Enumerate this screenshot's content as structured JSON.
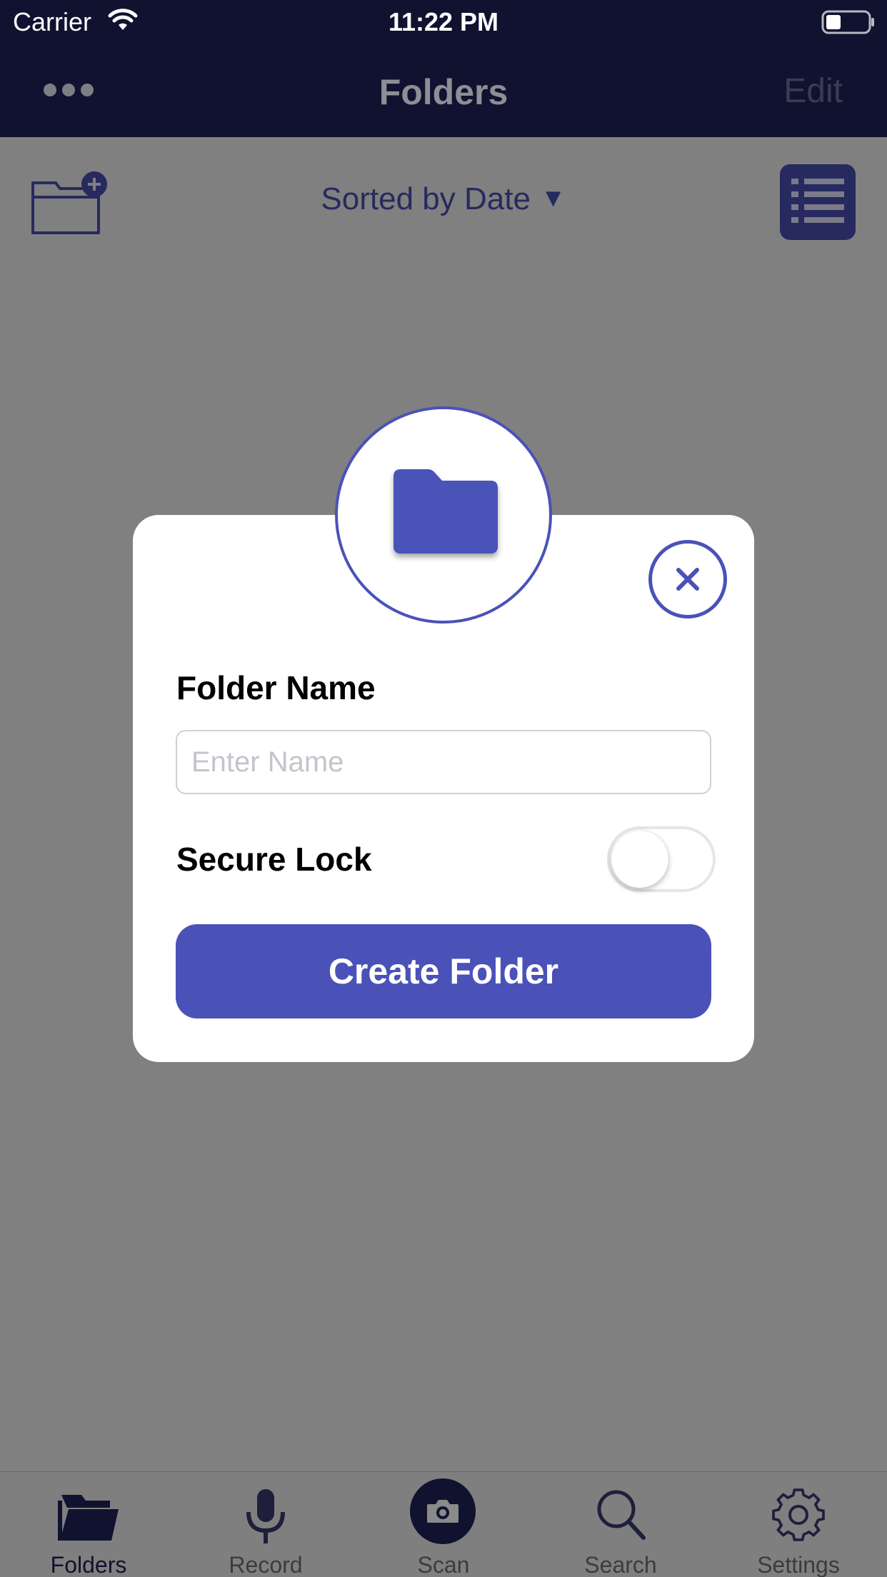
{
  "status_bar": {
    "carrier": "Carrier",
    "time": "11:22 PM"
  },
  "nav": {
    "title": "Folders",
    "edit_label": "Edit"
  },
  "toolbar": {
    "sort_label": "Sorted by Date",
    "sort_caret": "▼"
  },
  "modal": {
    "folder_name_label": "Folder Name",
    "name_placeholder": "Enter Name",
    "name_value": "",
    "secure_lock_label": "Secure Lock",
    "secure_lock_on": false,
    "create_button_label": "Create Folder"
  },
  "tabs": [
    {
      "label": "Folders",
      "icon": "folder-icon",
      "active": true
    },
    {
      "label": "Record",
      "icon": "microphone-icon",
      "active": false
    },
    {
      "label": "Scan",
      "icon": "camera-icon",
      "active": false
    },
    {
      "label": "Search",
      "icon": "search-icon",
      "active": false
    },
    {
      "label": "Settings",
      "icon": "gear-icon",
      "active": false
    }
  ],
  "colors": {
    "accent": "#4a52b8",
    "nav_bg": "#10122f",
    "overlay_bg": "#808080",
    "modal_bg": "#ffffff"
  }
}
